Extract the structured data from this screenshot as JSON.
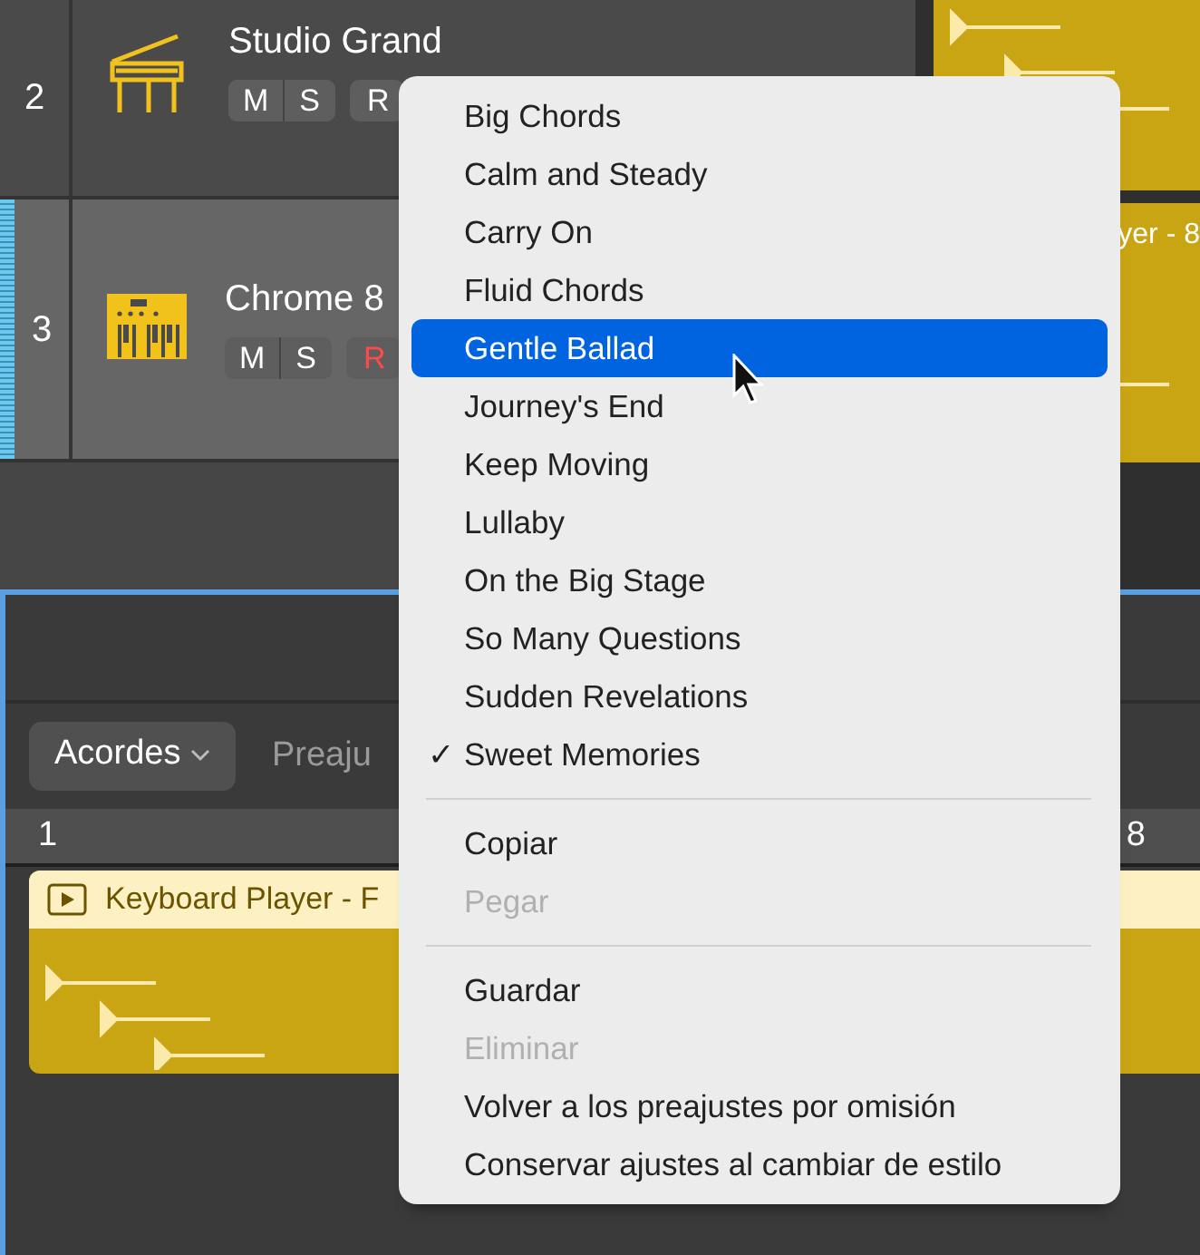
{
  "tracks": [
    {
      "number": "2",
      "name": "Studio Grand",
      "selected": false,
      "buttons": [
        {
          "label": "M",
          "kind": "mute"
        },
        {
          "label": "S",
          "kind": "solo"
        },
        {
          "label": "R",
          "kind": "record"
        }
      ],
      "record_armed": false
    },
    {
      "number": "3",
      "name": "Chrome 8",
      "selected": true,
      "buttons": [
        {
          "label": "M",
          "kind": "mute"
        },
        {
          "label": "S",
          "kind": "solo"
        },
        {
          "label": "R",
          "kind": "record"
        }
      ],
      "record_armed": true
    }
  ],
  "arrange_region": {
    "title": "yer - 8"
  },
  "editor": {
    "chords_button": "Acordes",
    "presets_label": "Preaju",
    "ruler": [
      "1",
      "8"
    ],
    "region_title": "Keyboard Player - F"
  },
  "menu": {
    "check_mark": "✓",
    "items": [
      {
        "kind": "item",
        "label": "Big Chords",
        "selected": false,
        "checked": false,
        "disabled": false
      },
      {
        "kind": "item",
        "label": "Calm and Steady",
        "selected": false,
        "checked": false,
        "disabled": false
      },
      {
        "kind": "item",
        "label": "Carry On",
        "selected": false,
        "checked": false,
        "disabled": false
      },
      {
        "kind": "item",
        "label": "Fluid Chords",
        "selected": false,
        "checked": false,
        "disabled": false
      },
      {
        "kind": "item",
        "label": "Gentle Ballad",
        "selected": true,
        "checked": false,
        "disabled": false
      },
      {
        "kind": "item",
        "label": "Journey's End",
        "selected": false,
        "checked": false,
        "disabled": false
      },
      {
        "kind": "item",
        "label": "Keep Moving",
        "selected": false,
        "checked": false,
        "disabled": false
      },
      {
        "kind": "item",
        "label": "Lullaby",
        "selected": false,
        "checked": false,
        "disabled": false
      },
      {
        "kind": "item",
        "label": "On the Big Stage",
        "selected": false,
        "checked": false,
        "disabled": false
      },
      {
        "kind": "item",
        "label": "So Many Questions",
        "selected": false,
        "checked": false,
        "disabled": false
      },
      {
        "kind": "item",
        "label": "Sudden Revelations",
        "selected": false,
        "checked": false,
        "disabled": false
      },
      {
        "kind": "item",
        "label": "Sweet Memories",
        "selected": false,
        "checked": true,
        "disabled": false
      },
      {
        "kind": "separator"
      },
      {
        "kind": "item",
        "label": "Copiar",
        "selected": false,
        "checked": false,
        "disabled": false
      },
      {
        "kind": "item",
        "label": "Pegar",
        "selected": false,
        "checked": false,
        "disabled": true
      },
      {
        "kind": "separator"
      },
      {
        "kind": "item",
        "label": "Guardar",
        "selected": false,
        "checked": false,
        "disabled": false
      },
      {
        "kind": "item",
        "label": "Eliminar",
        "selected": false,
        "checked": false,
        "disabled": true
      },
      {
        "kind": "item",
        "label": "Volver a los preajustes por omisión",
        "selected": false,
        "checked": false,
        "disabled": false
      },
      {
        "kind": "item",
        "label": "Conservar ajustes al cambiar de estilo",
        "selected": false,
        "checked": false,
        "disabled": false
      }
    ]
  }
}
